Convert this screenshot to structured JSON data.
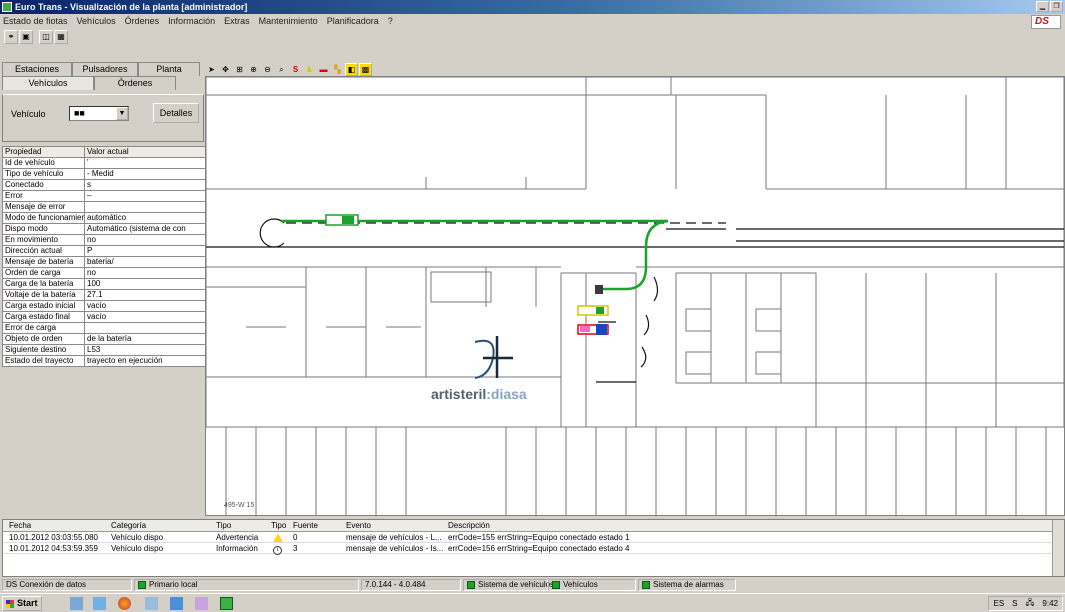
{
  "window": {
    "title": "Euro Trans - Visualización de la planta [administrador]",
    "controls": [
      "minimize-icon",
      "restore-icon"
    ]
  },
  "menu": [
    "Estado de fiotas",
    "Vehículos",
    "Órdenes",
    "Información",
    "Extras",
    "Mantenimiento",
    "Planificadora",
    "?"
  ],
  "brand_logo": "DS",
  "left_panel": {
    "tabs_top": [
      "Estaciones",
      "Pulsadores",
      "Planta"
    ],
    "tabs_bottom": [
      "Vehículos",
      "Órdenes"
    ],
    "vehicle_label": "Vehículo",
    "vehicle_value": "■■",
    "detail_button": "Detalles",
    "table_headers": [
      "Propiedad",
      "Valor actual"
    ],
    "rows": [
      [
        "Id de vehículo",
        "'"
      ],
      [
        "Tipo de vehículo",
        "- Medid"
      ],
      [
        "Conectado",
        "s"
      ],
      [
        "Error",
        "–"
      ],
      [
        "Mensaje de error",
        ""
      ],
      [
        "Modo de funcionamiento",
        "automático"
      ],
      [
        "Dispo modo",
        "Automático (sistema de con"
      ],
      [
        "En movimiento",
        "no"
      ],
      [
        "Dirección actual",
        "P"
      ],
      [
        "Mensaje de batería",
        "bateria/"
      ],
      [
        "Orden de carga",
        "no"
      ],
      [
        "Carga de la batería",
        "100"
      ],
      [
        "Voltaje de la batería",
        "27.1"
      ],
      [
        "Carga estado inicial",
        "vacío"
      ],
      [
        "Carga estado final",
        "vacío"
      ],
      [
        "Error de carga",
        ""
      ],
      [
        "Objeto de orden",
        "de la batería"
      ],
      [
        "Siguiente destino",
        "L53"
      ],
      [
        "Estado del trayecto",
        "trayecto en ejecución"
      ]
    ]
  },
  "map": {
    "logo_text_main": "artisteril",
    "logo_text_sub": ":diasa",
    "coords_label": "495-W 15"
  },
  "events": {
    "headers": [
      "Fecha",
      "Categoría",
      "Tipo",
      "Tipo",
      "Fuente",
      "Evento",
      "Descripción"
    ],
    "rows": [
      {
        "date": "10.01.2012 03:03:55.080",
        "category": "Vehículo dispo",
        "type": "Advertencia",
        "icon": "warning-icon",
        "source": "0",
        "event": "mensaje de vehículos - L...",
        "description": "errCode=155 errString=Equipo conectado estado 1"
      },
      {
        "date": "10.01.2012 04:53:59.359",
        "category": "Vehículo dispo",
        "type": "Información",
        "icon": "info-icon",
        "source": "3",
        "event": "mensaje de vehículos - Is...",
        "description": "errCode=156 errString=Equipo conectado estado 4"
      }
    ]
  },
  "status_bar": {
    "cell1": "DS Conexión de datos",
    "cell2": "Primario local",
    "cell3": "7.0.144 - 4.0.484",
    "cell4": "Sistema de vehículos",
    "cell5": "Vehículos",
    "cell6": "Sistema de alarmas"
  },
  "taskbar": {
    "start": "Start",
    "tray": [
      "ES",
      "S",
      "9:42"
    ]
  },
  "colors": {
    "route_green": "#1da12d",
    "title_blue": "#0a246a"
  }
}
